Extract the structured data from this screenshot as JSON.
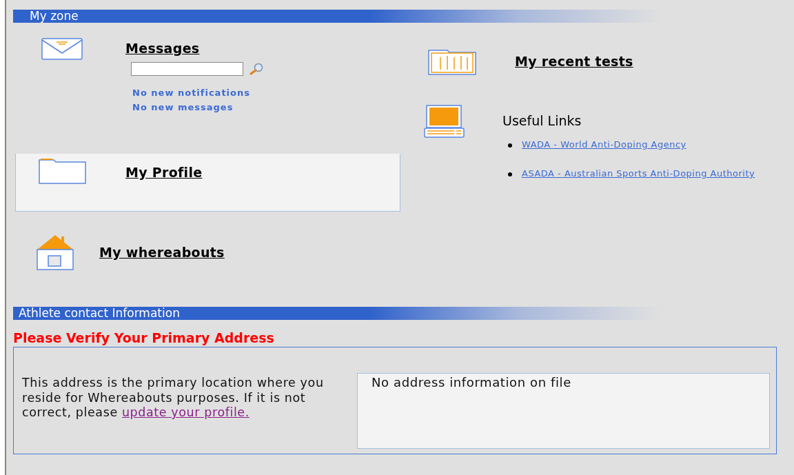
{
  "zone": {
    "title": "My zone",
    "messages": {
      "title": "Messages",
      "notices": [
        "No new notifications",
        "No new messages"
      ]
    },
    "profile": {
      "title": "My Profile"
    },
    "whereabouts": {
      "title": "My whereabouts"
    },
    "recent_tests": {
      "title": "My recent tests"
    },
    "useful_links": {
      "title": "Useful Links",
      "links": [
        "WADA - World Anti-Doping Agency",
        "ASADA - Australian Sports Anti-Doping Authority"
      ]
    }
  },
  "contact": {
    "title": "Athlete contact Information",
    "warning": "Please Verify Your Primary Address",
    "description": "This address is the primary location where you reside for Whereabouts purposes. If it is not correct, please",
    "link": "update your profile.",
    "address": "No address information on file"
  }
}
